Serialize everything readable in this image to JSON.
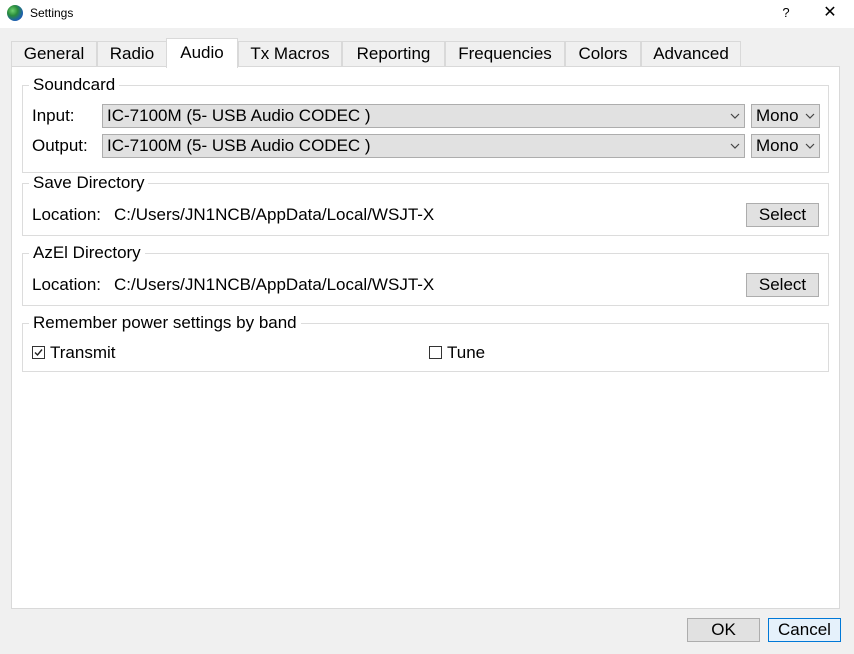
{
  "window": {
    "title": "Settings",
    "help_glyph": "?",
    "close_glyph": "✕"
  },
  "tabs": [
    {
      "label": "General"
    },
    {
      "label": "Radio"
    },
    {
      "label": "Audio"
    },
    {
      "label": "Tx Macros"
    },
    {
      "label": "Reporting"
    },
    {
      "label": "Frequencies"
    },
    {
      "label": "Colors"
    },
    {
      "label": "Advanced"
    }
  ],
  "active_tab": "Audio",
  "soundcard": {
    "title": "Soundcard",
    "input_label": "Input:",
    "input_device": "IC-7100M (5- USB Audio CODEC )",
    "input_channel": "Mono",
    "output_label": "Output:",
    "output_device": "IC-7100M (5- USB Audio CODEC )",
    "output_channel": "Mono"
  },
  "save_directory": {
    "title": "Save Directory",
    "location_label": "Location:",
    "path": "C:/Users/JN1NCB/AppData/Local/WSJT-X",
    "select_label": "Select"
  },
  "azel_directory": {
    "title": "AzEl Directory",
    "location_label": "Location:",
    "path": "C:/Users/JN1NCB/AppData/Local/WSJT-X",
    "select_label": "Select"
  },
  "power_settings": {
    "title": "Remember power settings by band",
    "transmit_label": "Transmit",
    "transmit_checked": true,
    "tune_label": "Tune",
    "tune_checked": false
  },
  "footer": {
    "ok_label": "OK",
    "cancel_label": "Cancel"
  }
}
